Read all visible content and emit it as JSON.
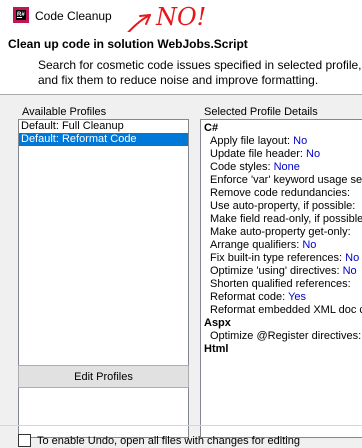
{
  "window": {
    "title": "Code Cleanup",
    "annotation": "NO!"
  },
  "header": {
    "title": "Clean up code in solution WebJobs.Script",
    "description": "Search for cosmetic code issues specified in selected profile, and fix them to reduce noise and improve formatting."
  },
  "available_profiles": {
    "label": "Available Profiles",
    "items": [
      {
        "label": "Default: Full Cleanup",
        "selected": false
      },
      {
        "label": "Default: Reformat Code",
        "selected": true
      }
    ]
  },
  "selected_profile_details": {
    "label": "Selected Profile Details",
    "sections": [
      {
        "name": "C#",
        "rows": [
          {
            "label": "Apply file layout:",
            "value": "No"
          },
          {
            "label": "Update file header:",
            "value": "No"
          },
          {
            "label": "Code styles:",
            "value": "None"
          },
          {
            "label": "Enforce 'var' keyword usage settings:",
            "value": ""
          },
          {
            "label": "Remove code redundancies:",
            "value": ""
          },
          {
            "label": "Use auto-property, if possible:",
            "value": ""
          },
          {
            "label": "Make field read-only, if possible:",
            "value": ""
          },
          {
            "label": "Make auto-property get-only:",
            "value": ""
          },
          {
            "label": "Arrange qualifiers:",
            "value": "No"
          },
          {
            "label": "Fix built-in type references:",
            "value": "No"
          },
          {
            "label": "Optimize 'using' directives:",
            "value": "No"
          },
          {
            "label": "Shorten qualified references:",
            "value": ""
          },
          {
            "label": "Reformat code:",
            "value": "Yes"
          },
          {
            "label": "Reformat embedded XML doc comments:",
            "value": ""
          }
        ]
      },
      {
        "name": "Aspx",
        "rows": [
          {
            "label": "Optimize @Register directives:",
            "value": ""
          }
        ]
      },
      {
        "name": "Html",
        "rows": []
      }
    ]
  },
  "buttons": {
    "edit_profiles": "Edit Profiles"
  },
  "undo": {
    "checked": false,
    "label": "To enable Undo, open all files with changes for editing"
  },
  "colors": {
    "selection": "#0078d7",
    "value_text": "#0000c8",
    "annotation_red": "#e8161b"
  },
  "icons": {
    "app": "resharper-icon",
    "checkbox": "checkbox-icon"
  }
}
